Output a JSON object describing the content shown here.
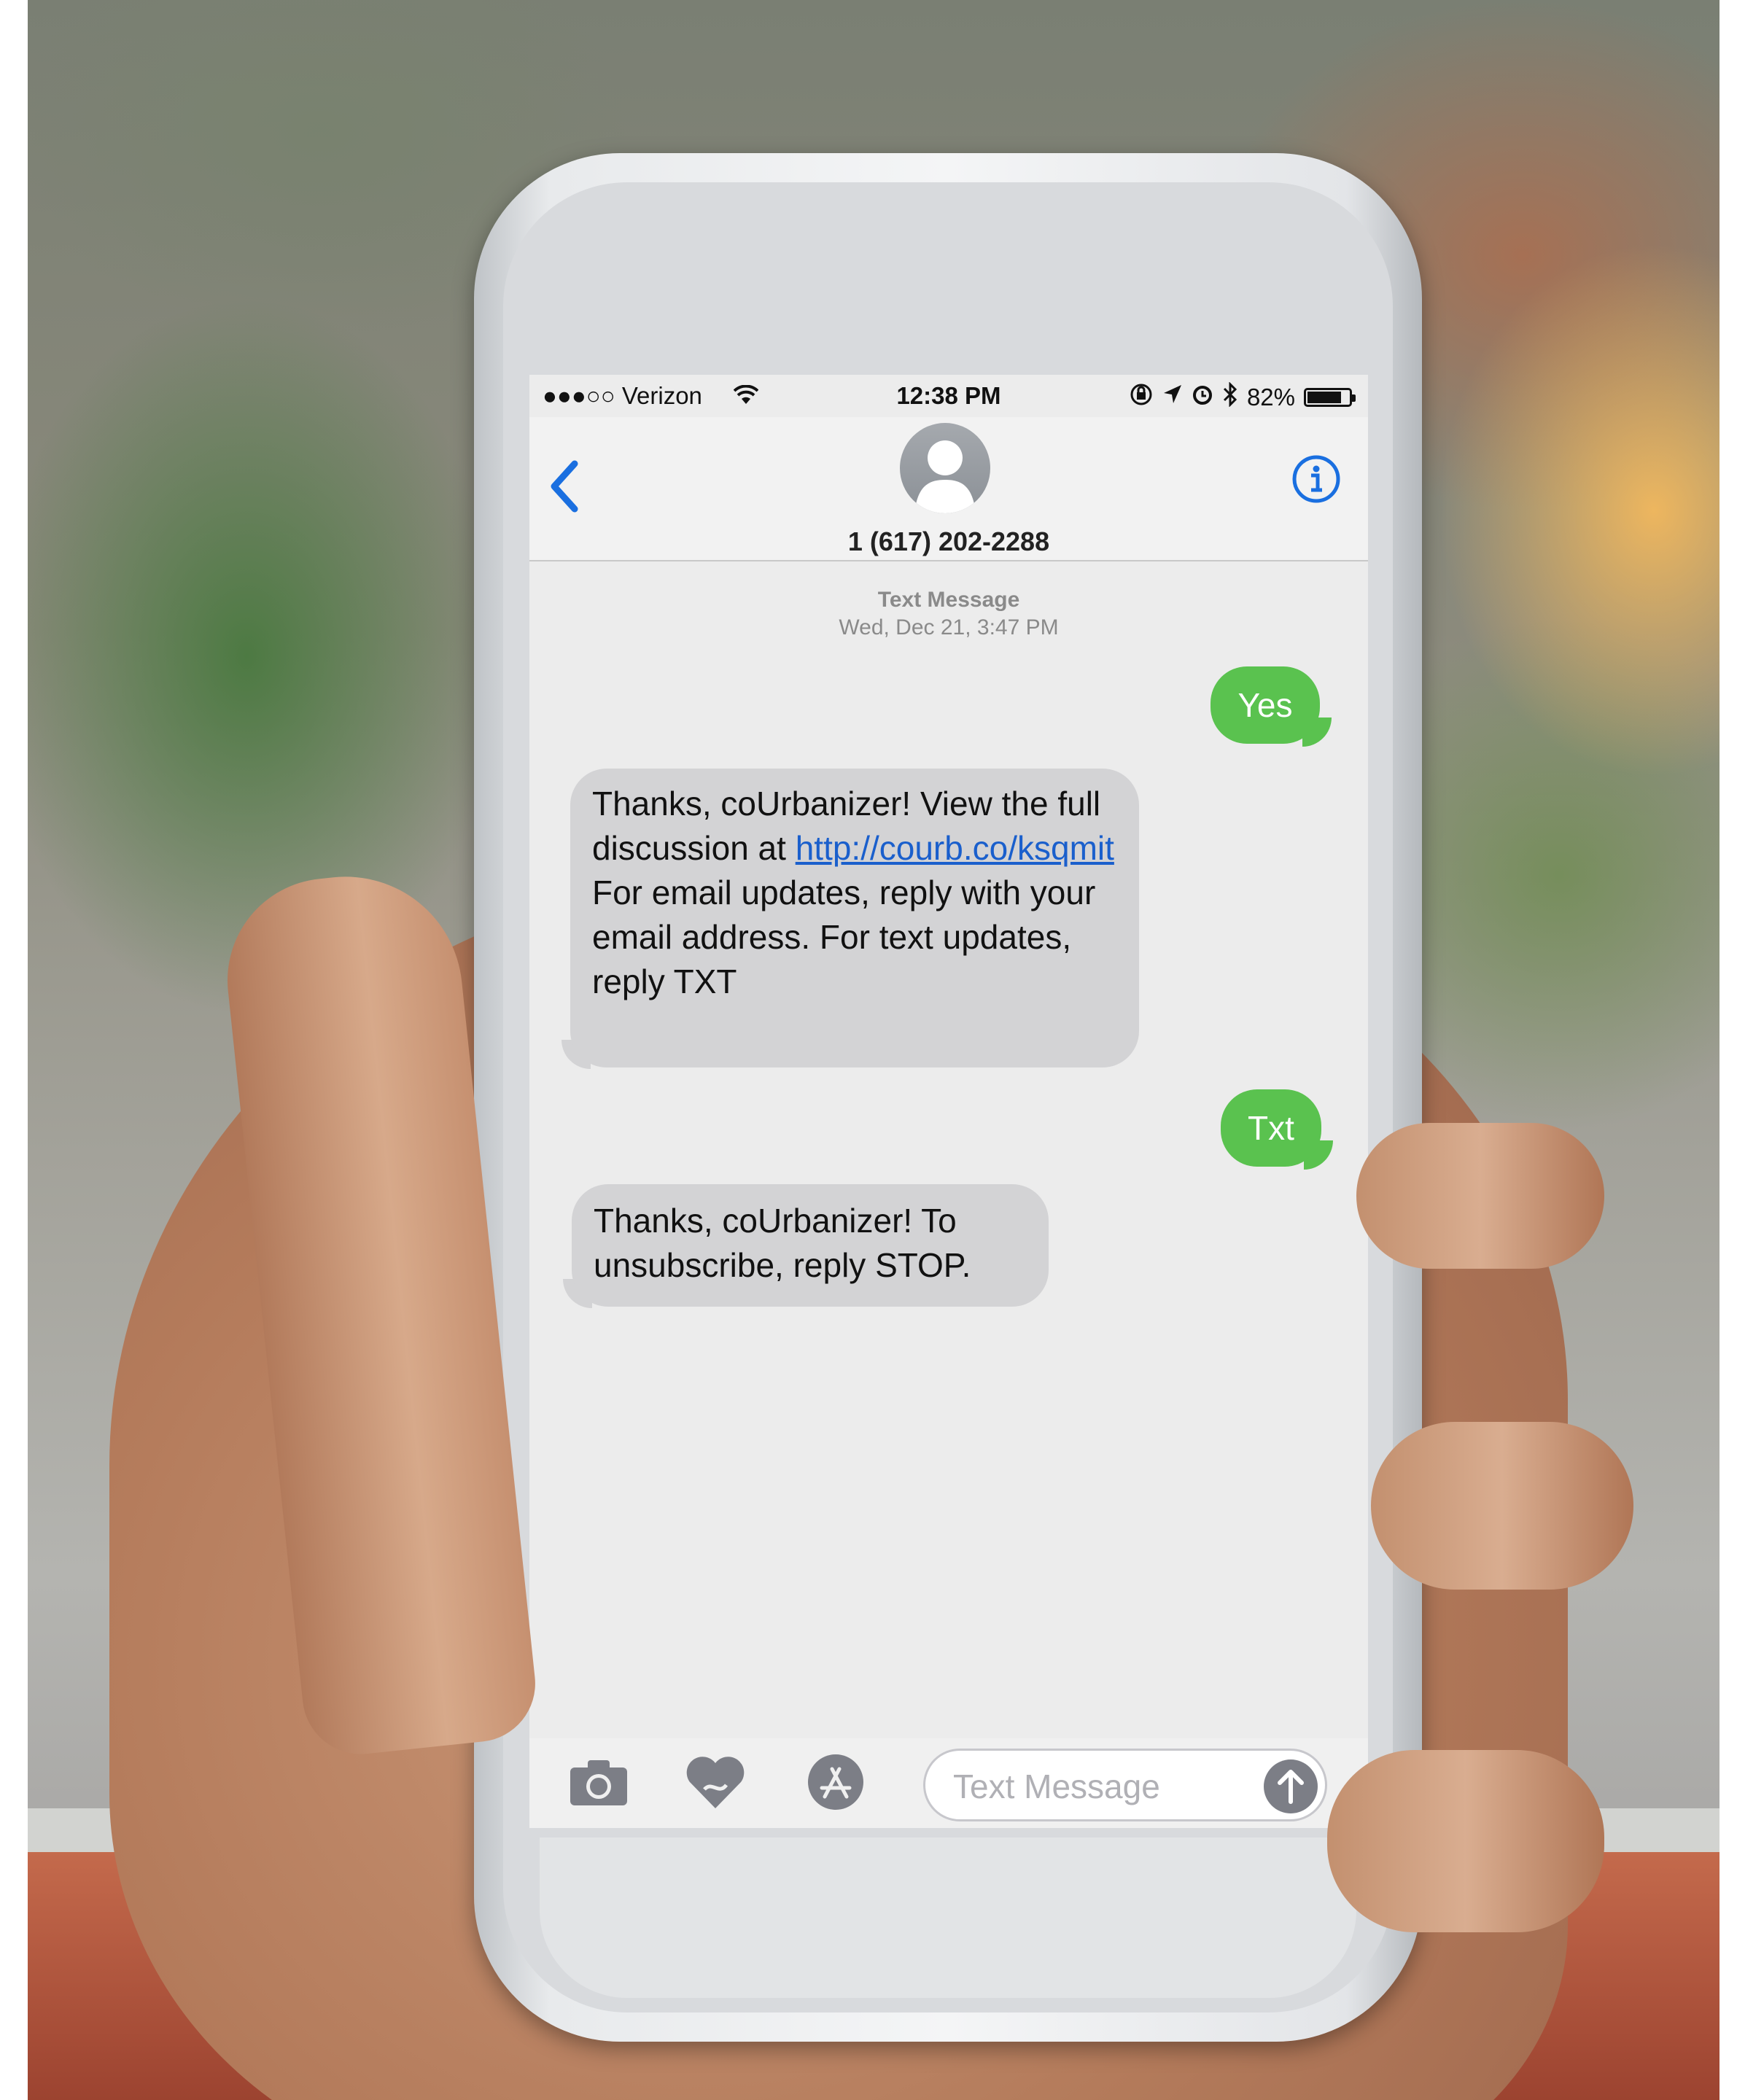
{
  "status_bar": {
    "carrier": "●●●○○ Verizon",
    "time": "12:38 PM",
    "battery_percent": "82%",
    "battery_level": 0.82
  },
  "header": {
    "back_icon": "chevron-left-icon",
    "contact": "1 (617) 202-2288",
    "info_icon": "info-icon"
  },
  "thread": {
    "label": "Text Message",
    "date": "Wed, Dec 21, 3:47 PM",
    "messages": [
      {
        "direction": "outgoing",
        "text": "Yes"
      },
      {
        "direction": "incoming",
        "text_before": "Thanks, coUrbanizer! View the full discussion at ",
        "link": "http://courb.co/ksqmit",
        "text_after": " For email updates, reply with your email address. For text updates, reply TXT"
      },
      {
        "direction": "outgoing",
        "text": "Txt"
      },
      {
        "direction": "incoming",
        "text": "Thanks, coUrbanizer! To unsubscribe, reply STOP."
      }
    ]
  },
  "input_bar": {
    "placeholder": "Text Message",
    "icons": [
      "camera-icon",
      "digital-touch-icon",
      "app-store-icon",
      "send-arrow-icon"
    ]
  },
  "colors": {
    "outgoing_bubble": "#5ac24f",
    "incoming_bubble": "#d3d3d5",
    "link": "#1a5fcc",
    "accent": "#1a73e8"
  }
}
